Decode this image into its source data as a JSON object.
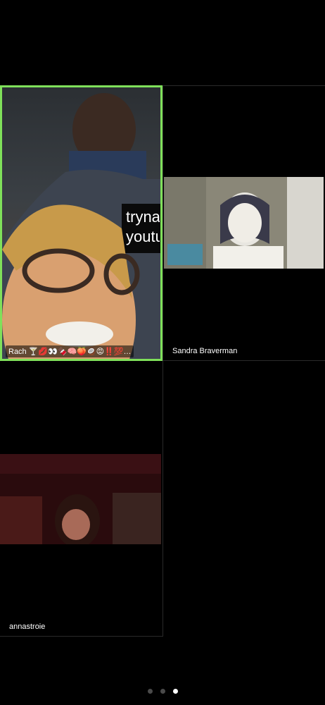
{
  "participants": [
    {
      "name": "Rach 🍸💋👀🍫🧠🍑🥥😡‼️💯…"
    },
    {
      "name": "Sandra Braverman"
    },
    {
      "name": "annastroie"
    }
  ],
  "rach_overlay_text": "tryna youtu",
  "pagination": {
    "total_pages": 3,
    "current_page": 3
  },
  "colors": {
    "active_speaker_border": "#7fe05a",
    "background": "#000000",
    "inactive_dot": "#4a4a4a",
    "active_dot": "#ffffff"
  }
}
